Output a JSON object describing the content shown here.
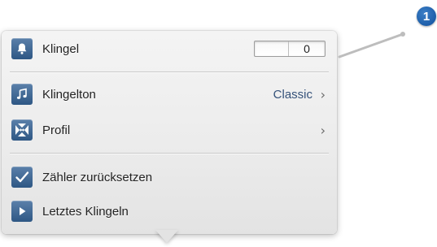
{
  "popover": {
    "rows": [
      {
        "label": "Klingel",
        "icon": "bell-icon",
        "counter_value": "0"
      },
      {
        "label": "Klingelton",
        "icon": "music-note-icon",
        "value": "Classic",
        "chevron": "›"
      },
      {
        "label": "Profil",
        "icon": "profile-icon",
        "chevron": "›"
      },
      {
        "label": "Zähler zurücksetzen",
        "icon": "checkmark-icon"
      },
      {
        "label": "Letztes Klingeln",
        "icon": "play-icon"
      }
    ]
  },
  "callout": {
    "number": "1"
  },
  "colors": {
    "icon_blue": "#2e5784",
    "value_blue": "#35527a",
    "badge_blue": "#1d5ea9"
  }
}
